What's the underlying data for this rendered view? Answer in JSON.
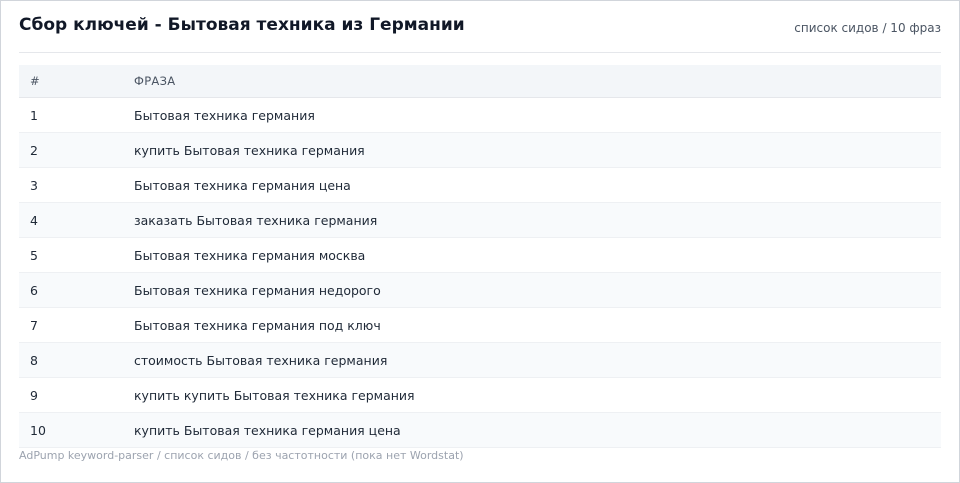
{
  "page": {
    "title": "Сбор ключей - Бытовая техника из Германии",
    "meta": "список сидов / 10 фраз"
  },
  "table": {
    "columns": [
      "#",
      "ФРАЗА"
    ],
    "rows": [
      {
        "num": "1",
        "phrase": "Бытовая техника германия"
      },
      {
        "num": "2",
        "phrase": "купить Бытовая техника германия"
      },
      {
        "num": "3",
        "phrase": "Бытовая техника германия цена"
      },
      {
        "num": "4",
        "phrase": "заказать Бытовая техника германия"
      },
      {
        "num": "5",
        "phrase": "Бытовая техника германия москва"
      },
      {
        "num": "6",
        "phrase": "Бытовая техника германия недорого"
      },
      {
        "num": "7",
        "phrase": "Бытовая техника германия под ключ"
      },
      {
        "num": "8",
        "phrase": "стоимость Бытовая техника германия"
      },
      {
        "num": "9",
        "phrase": "купить купить Бытовая техника германия"
      },
      {
        "num": "10",
        "phrase": "купить Бытовая техника германия цена"
      }
    ]
  },
  "footer": {
    "text": "AdPump keyword-parser / список сидов / без частотности (пока нет Wordstat)"
  }
}
